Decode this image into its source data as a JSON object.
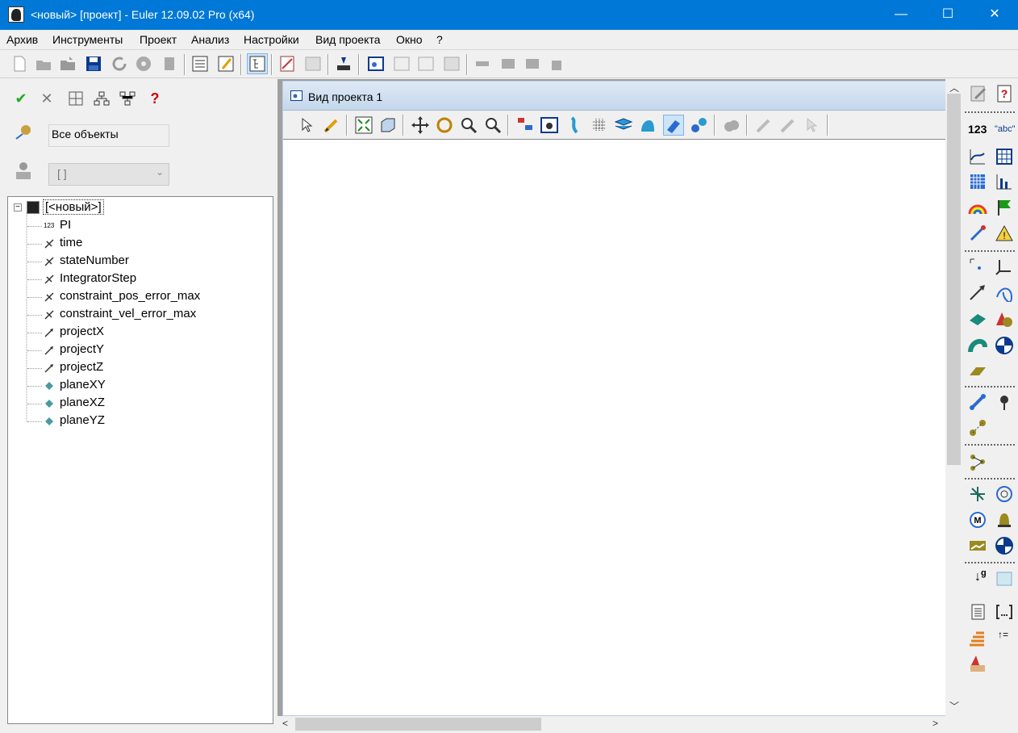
{
  "window": {
    "title": "<новый> [проект] - Euler 12.09.02 Pro (x64)",
    "minimize": "—",
    "maximize": "☐",
    "close": "✕"
  },
  "menu": [
    "Архив",
    "Инструменты",
    "Проект",
    "Анализ",
    "Настройки",
    "Вид проекта",
    "Окно",
    "?"
  ],
  "left_panel": {
    "filter_value": "Все объекты",
    "combo_value": "[ ]",
    "tree_root": "[<новый>]",
    "tree_items": [
      {
        "label": "PI",
        "icon": "number-icon",
        "icon_text": "123"
      },
      {
        "label": "time",
        "icon": "variable-icon"
      },
      {
        "label": "stateNumber",
        "icon": "variable-icon"
      },
      {
        "label": "IntegratorStep",
        "icon": "variable-icon"
      },
      {
        "label": "constraint_pos_error_max",
        "icon": "variable-icon"
      },
      {
        "label": "constraint_vel_error_max",
        "icon": "variable-icon"
      },
      {
        "label": "projectX",
        "icon": "vector-icon"
      },
      {
        "label": "projectY",
        "icon": "vector-icon"
      },
      {
        "label": "projectZ",
        "icon": "vector-icon"
      },
      {
        "label": "planeXY",
        "icon": "plane-icon"
      },
      {
        "label": "planeXZ",
        "icon": "plane-icon"
      },
      {
        "label": "planeYZ",
        "icon": "plane-icon"
      }
    ]
  },
  "project_view": {
    "title": "Вид проекта 1"
  },
  "right_panel": {
    "number_label": "123",
    "text_label": "\"abc\"",
    "gravity_label": "g"
  },
  "colors": {
    "titlebar": "#0078d7",
    "check": "#22aa22",
    "help": "#cc0000"
  }
}
